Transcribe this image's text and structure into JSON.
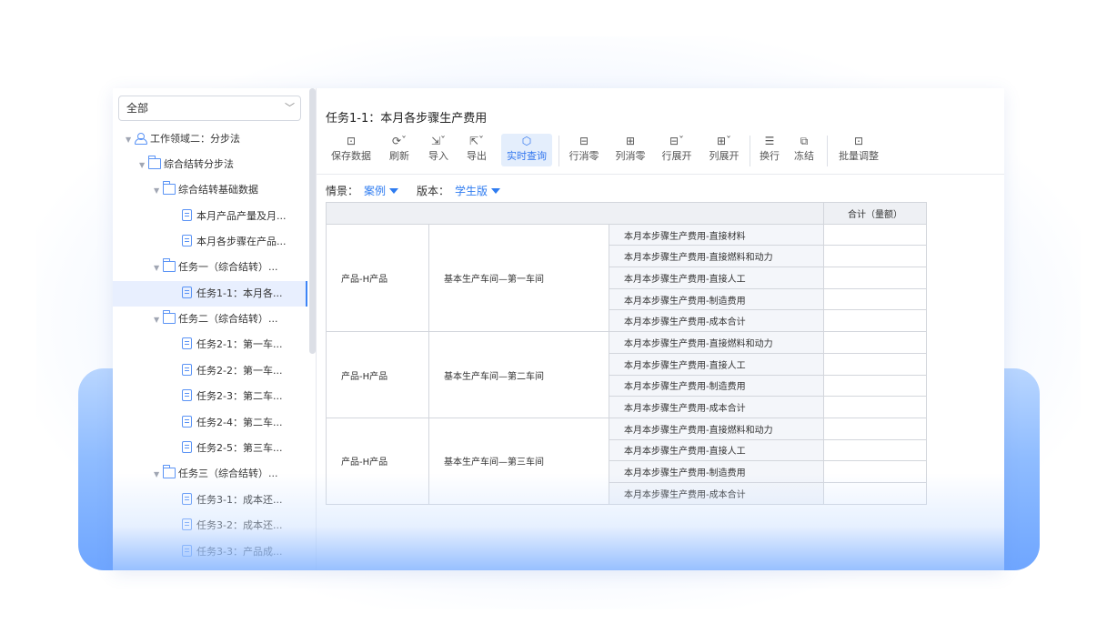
{
  "sidebar": {
    "select_value": "全部",
    "tree": [
      {
        "label": "工作领域二：分步法",
        "kind": "root"
      },
      {
        "label": "综合结转分步法",
        "kind": "folder"
      },
      {
        "label": "综合结转基础数据",
        "kind": "folder"
      },
      {
        "label": "本月产品产量及月...",
        "kind": "doc"
      },
      {
        "label": "本月各步骤在产品...",
        "kind": "doc"
      },
      {
        "label": "任务一（综合结转）...",
        "kind": "folder"
      },
      {
        "label": "任务1-1：本月各...",
        "kind": "doc",
        "selected": true
      },
      {
        "label": "任务二（综合结转）...",
        "kind": "folder"
      },
      {
        "label": "任务2-1：第一车...",
        "kind": "doc"
      },
      {
        "label": "任务2-2：第一车...",
        "kind": "doc"
      },
      {
        "label": "任务2-3：第二车...",
        "kind": "doc"
      },
      {
        "label": "任务2-4：第二车...",
        "kind": "doc"
      },
      {
        "label": "任务2-5：第三车...",
        "kind": "doc"
      },
      {
        "label": "任务三（综合结转）...",
        "kind": "folder"
      },
      {
        "label": "任务3-1：成本还...",
        "kind": "doc"
      },
      {
        "label": "任务3-2：成本还...",
        "kind": "doc"
      },
      {
        "label": "任务3-3：产品成...",
        "kind": "doc"
      }
    ]
  },
  "main": {
    "title": "任务1-1：本月各步骤生产费用",
    "toolbar": [
      {
        "label": "保存数据",
        "icon": "save-icon"
      },
      {
        "label": "刷新",
        "icon": "refresh-icon"
      },
      {
        "label": "导入",
        "icon": "import-icon"
      },
      {
        "label": "导出",
        "icon": "export-icon"
      },
      {
        "label": "实时查询",
        "icon": "realtime-query-icon",
        "active": true
      },
      {
        "label": "行消零",
        "icon": "row-zero-icon"
      },
      {
        "label": "列消零",
        "icon": "column-zero-icon"
      },
      {
        "label": "行展开",
        "icon": "row-expand-icon"
      },
      {
        "label": "列展开",
        "icon": "column-expand-icon"
      },
      {
        "label": "换行",
        "icon": "wrap-icon"
      },
      {
        "label": "冻结",
        "icon": "freeze-icon"
      },
      {
        "label": "批量调整",
        "icon": "batch-adjust-icon"
      }
    ],
    "filters": {
      "scenario_label": "情景：",
      "scenario_value": "案例",
      "version_label": "版本：",
      "version_value": "学生版"
    },
    "table": {
      "header_total": "合计（量额）",
      "groups": [
        {
          "product": "产品-H产品",
          "workshop": "基本生产车间—第一车间",
          "items": [
            "本月本步骤生产费用-直接材料",
            "本月本步骤生产费用-直接燃料和动力",
            "本月本步骤生产费用-直接人工",
            "本月本步骤生产费用-制造费用",
            "本月本步骤生产费用-成本合计"
          ]
        },
        {
          "product": "产品-H产品",
          "workshop": "基本生产车间—第二车间",
          "items": [
            "本月本步骤生产费用-直接燃料和动力",
            "本月本步骤生产费用-直接人工",
            "本月本步骤生产费用-制造费用",
            "本月本步骤生产费用-成本合计"
          ]
        },
        {
          "product": "产品-H产品",
          "workshop": "基本生产车间—第三车间",
          "items": [
            "本月本步骤生产费用-直接燃料和动力",
            "本月本步骤生产费用-直接人工",
            "本月本步骤生产费用-制造费用",
            "本月本步骤生产费用-成本合计"
          ]
        }
      ]
    }
  },
  "colors": {
    "accent": "#2f7cf0",
    "selected_bg": "#e8effe",
    "base_blue": "#6fa6ff"
  }
}
